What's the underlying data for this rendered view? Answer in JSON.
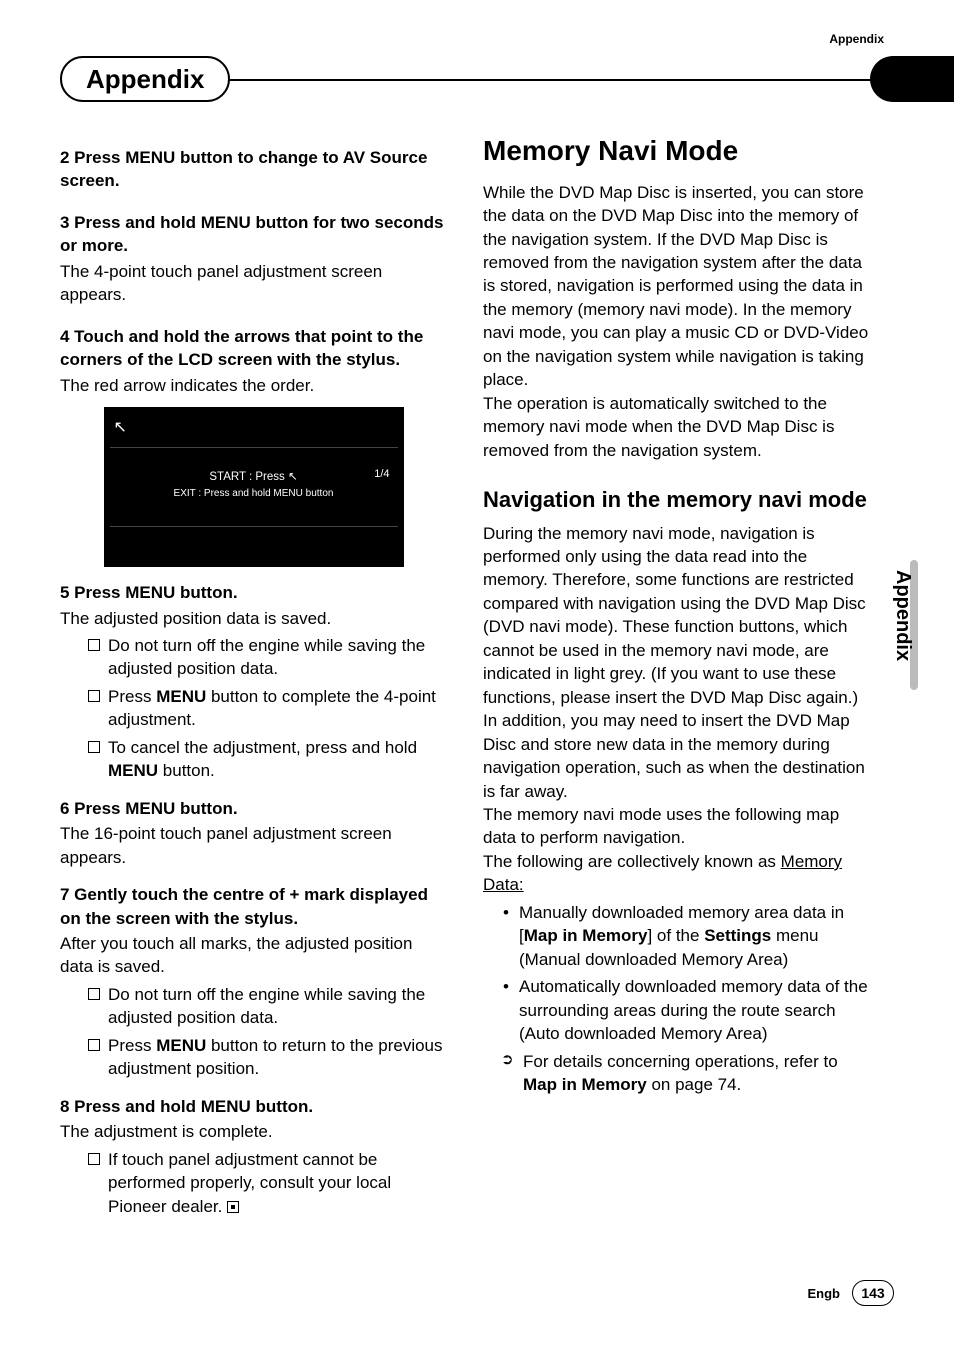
{
  "top_label": "Appendix",
  "tab_title": "Appendix",
  "side_label": "Appendix",
  "left": {
    "step2": {
      "head": "2   Press MENU button to change to AV Source screen."
    },
    "step3": {
      "head": "3   Press and hold MENU button for two seconds or more.",
      "body": "The 4-point touch panel adjustment screen appears."
    },
    "step4": {
      "head": "4   Touch and hold the arrows that point to the corners of the LCD screen with the stylus.",
      "body": "The red arrow indicates the order."
    },
    "screen": {
      "line1_a": "START : Press ",
      "line1_b": "↖",
      "line2": "EXIT : Press and hold MENU button",
      "count": "1/4",
      "arrow": "↖"
    },
    "step5": {
      "head": "5   Press MENU button.",
      "body": "The adjusted position data is saved.",
      "b1": "Do not turn off the engine while saving the adjusted position data.",
      "b2_a": "Press ",
      "b2_b": "MENU",
      "b2_c": " button to complete the 4-point adjustment.",
      "b3_a": "To cancel the adjustment, press and hold ",
      "b3_b": "MENU",
      "b3_c": " button."
    },
    "step6": {
      "head": "6   Press MENU button.",
      "body": "The 16-point touch panel adjustment screen appears."
    },
    "step7": {
      "head": "7   Gently touch the centre of + mark displayed on the screen with the stylus.",
      "body": "After you touch all marks, the adjusted position data is saved.",
      "b1": "Do not turn off the engine while saving the adjusted position data.",
      "b2_a": "Press ",
      "b2_b": "MENU",
      "b2_c": " button to return to the previous adjustment position."
    },
    "step8": {
      "head": "8   Press and hold MENU button.",
      "body": "The adjustment is complete.",
      "b1": "If touch panel adjustment cannot be performed properly, consult your local Pioneer dealer."
    }
  },
  "right": {
    "h1": "Memory Navi Mode",
    "p1": "While the DVD Map Disc is inserted, you can store the data on the DVD Map Disc into the memory of the navigation system. If the DVD Map Disc is removed from the navigation system after the data is stored, navigation is performed using the data in the memory (memory navi mode). In the memory navi mode, you can play a music CD or DVD-Video on the navigation system while navigation is taking place.",
    "p2": "The operation is automatically switched to the memory navi mode when the DVD Map Disc is removed from the navigation system.",
    "h2": "Navigation in the memory navi mode",
    "p3": "During the memory navi mode, navigation is performed only using the data read into the memory. Therefore, some functions are restricted compared with navigation using the DVD Map Disc (DVD navi mode). These function buttons, which cannot be used in the memory navi mode, are indicated in light grey. (If you want to use these functions, please insert the DVD Map Disc again.) In addition, you may need to insert the DVD Map Disc and store new data in the memory during navigation operation, such as when the destination is far away.",
    "p4": "The memory navi mode uses the following map data to perform navigation.",
    "p5_a": "The following are collectively known as ",
    "p5_b": "Memory Data:",
    "li1_a": "Manually downloaded memory area data in [",
    "li1_b": "Map in Memory",
    "li1_c": "] of the ",
    "li1_d": "Settings",
    "li1_e": " menu (Manual downloaded Memory Area)",
    "li2": "Automatically downloaded memory data of the surrounding areas during the route search (Auto downloaded Memory Area)",
    "li3_a": "For details concerning operations, refer to ",
    "li3_b": "Map in Memory",
    "li3_c": " on page 74."
  },
  "footer": {
    "lang": "Engb",
    "page": "143"
  }
}
